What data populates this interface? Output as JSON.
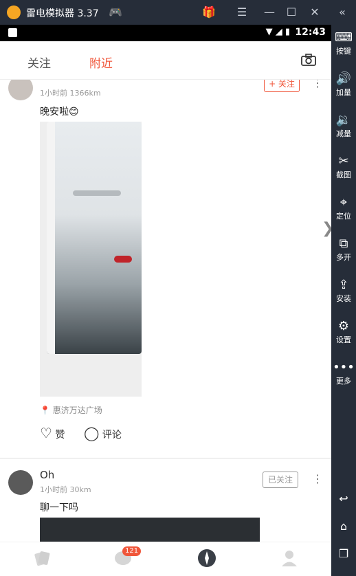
{
  "window": {
    "title": "雷电模拟器 3.37"
  },
  "titlebar_icons": [
    "gamepad-icon",
    "gift-icon",
    "menu-icon",
    "minimize-icon",
    "maximize-icon",
    "close-icon",
    "collapse-icon"
  ],
  "statusbar": {
    "time": "12:43"
  },
  "sidebar": {
    "items": [
      {
        "label": "按键",
        "icon": "keyboard-icon"
      },
      {
        "label": "加量",
        "icon": "volume-up-icon"
      },
      {
        "label": "减量",
        "icon": "volume-down-icon"
      },
      {
        "label": "截图",
        "icon": "scissors-icon"
      },
      {
        "label": "定位",
        "icon": "location-pin-icon"
      },
      {
        "label": "多开",
        "icon": "multi-instance-icon"
      },
      {
        "label": "安装",
        "icon": "apk-install-icon"
      },
      {
        "label": "设置",
        "icon": "gear-icon"
      },
      {
        "label": "更多",
        "icon": "more-dots-icon"
      }
    ],
    "bottom_icons": [
      "back-icon",
      "home-icon",
      "recent-apps-icon"
    ]
  },
  "tabs": {
    "follow": "关注",
    "nearby": "附近"
  },
  "posts": [
    {
      "username": "",
      "meta": "1小时前 1366km",
      "follow_label": "+ 关注",
      "text": "晚安啦😊",
      "location": "惠济万达广场",
      "like_label": "赞",
      "comment_label": "评论"
    },
    {
      "username": "Oh",
      "meta": "1小时前 30km",
      "follow_label": "已关注",
      "text": "聊一下吗"
    }
  ],
  "bottom_nav": {
    "badge": "121"
  },
  "colors": {
    "accent": "#f0563a",
    "sidebar_bg": "#262d39"
  }
}
